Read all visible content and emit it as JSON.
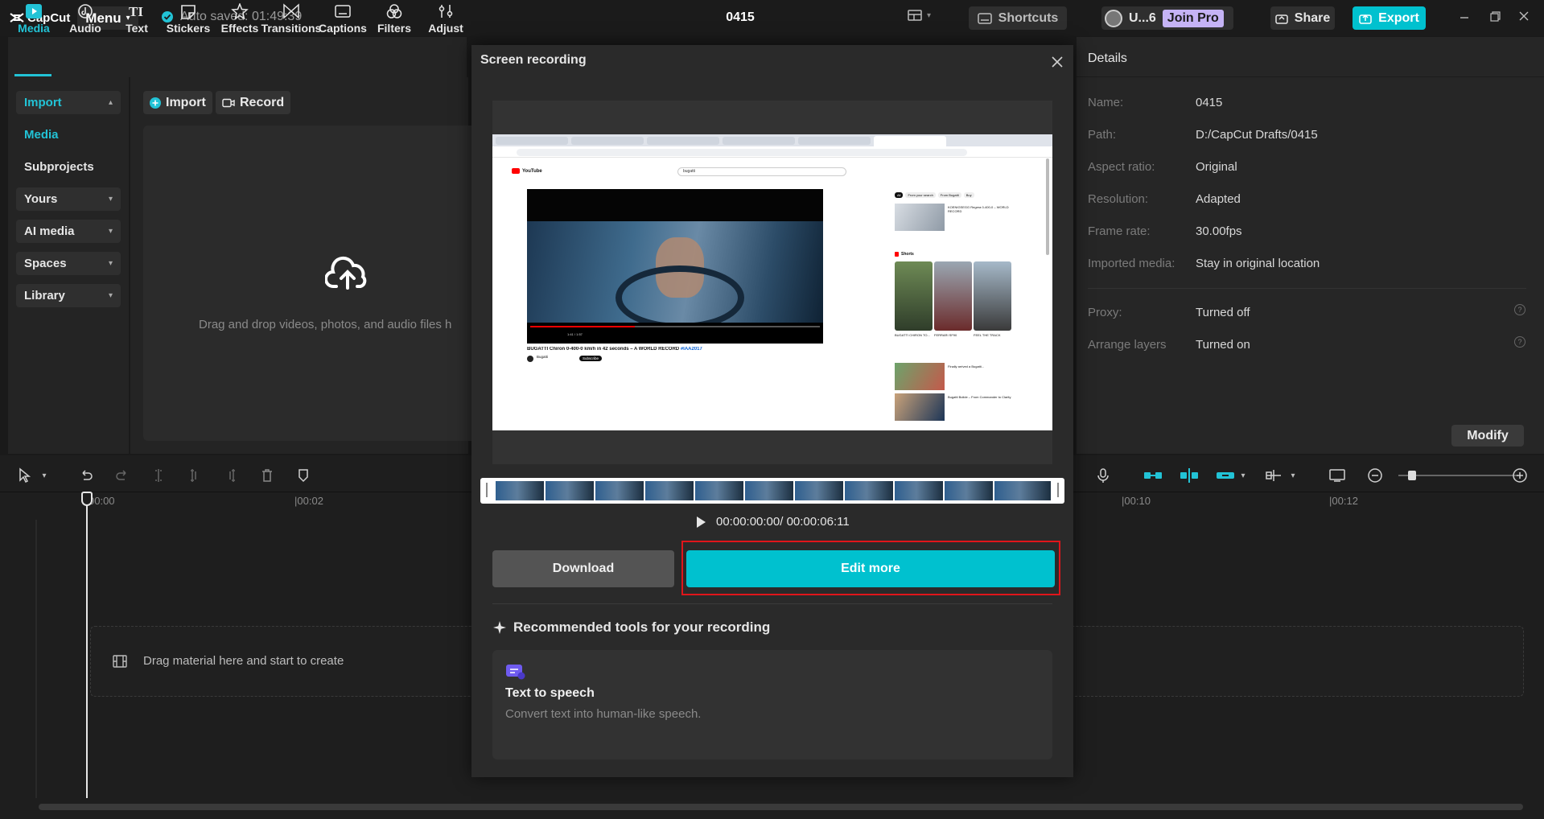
{
  "app": {
    "logo": "CapCut",
    "menu_label": "Menu",
    "autosave": "Auto saved: 01:49:39",
    "project_title": "0415",
    "shortcuts_label": "Shortcuts",
    "user_label": "U...6",
    "join_pro_label": "Join Pro",
    "share_label": "Share",
    "export_label": "Export"
  },
  "toolbar": {
    "tabs": [
      {
        "label": "Media",
        "icon": "media-icon"
      },
      {
        "label": "Audio",
        "icon": "audio-icon"
      },
      {
        "label": "Text",
        "icon": "text-icon"
      },
      {
        "label": "Stickers",
        "icon": "stickers-icon"
      },
      {
        "label": "Effects",
        "icon": "effects-icon"
      },
      {
        "label": "Transitions",
        "icon": "transitions-icon"
      },
      {
        "label": "Captions",
        "icon": "captions-icon"
      },
      {
        "label": "Filters",
        "icon": "filters-icon"
      },
      {
        "label": "Adjust",
        "icon": "adjust-icon"
      }
    ]
  },
  "sidebar": {
    "items": [
      {
        "label": "Import"
      },
      {
        "label": "Media"
      },
      {
        "label": "Subprojects"
      },
      {
        "label": "Yours"
      },
      {
        "label": "AI media"
      },
      {
        "label": "Spaces"
      },
      {
        "label": "Library"
      }
    ]
  },
  "media": {
    "import_label": "Import",
    "record_label": "Record",
    "drop_text": "Drag and drop videos, photos, and audio files h"
  },
  "details": {
    "header": "Details",
    "rows": [
      {
        "label": "Name:",
        "value": "0415"
      },
      {
        "label": "Path:",
        "value": "D:/CapCut Drafts/0415"
      },
      {
        "label": "Aspect ratio:",
        "value": "Original"
      },
      {
        "label": "Resolution:",
        "value": "Adapted"
      },
      {
        "label": "Frame rate:",
        "value": "30.00fps"
      },
      {
        "label": "Imported media:",
        "value": "Stay in original location"
      },
      {
        "label": "Proxy:",
        "value": "Turned off"
      },
      {
        "label": "Arrange layers",
        "value": "Turned on"
      }
    ],
    "modify_label": "Modify"
  },
  "timeline": {
    "ruler": [
      "00:00",
      "00:02",
      "00:10",
      "00:12"
    ],
    "drag_text": "Drag material here and start to create"
  },
  "modal": {
    "title": "Screen recording",
    "timecode": "00:00:00:00/ 00:00:06:11",
    "download_label": "Download",
    "edit_label": "Edit more",
    "recommended_title": "Recommended tools for your recording",
    "tool_title": "Text to speech",
    "tool_desc": "Convert text into human-like speech."
  },
  "preview": {
    "site": "YouTube",
    "search": "bugatti",
    "video_title": "BUGATTI Chiron 0-400-0 km/h in 42 seconds – A WORLD RECORD",
    "hashtag": "#IAA2017",
    "channel": "Bugatti",
    "subscribe": "Subscribe",
    "video_time": "1:41 / 1:57",
    "shorts": "Shorts",
    "chips": [
      "All",
      "From your search",
      "From Bugatti",
      "Buy"
    ],
    "short_titles": [
      "BUGATTI CHIRON TO...",
      "FERRARI SF90",
      "FEEL THE TRACK"
    ],
    "side_titles": [
      "KOENIGSEGG Regera 0-400-0 – WORLD RECORD",
      "Finally arrived a Bugatti...",
      "Bugatti Bolide – From Commander to Clarity"
    ]
  },
  "colors": {
    "accent": "#22c3d6",
    "edit_button": "#00c1cf",
    "highlight": "#e0151b",
    "join_pro": "#c5b3f5"
  }
}
